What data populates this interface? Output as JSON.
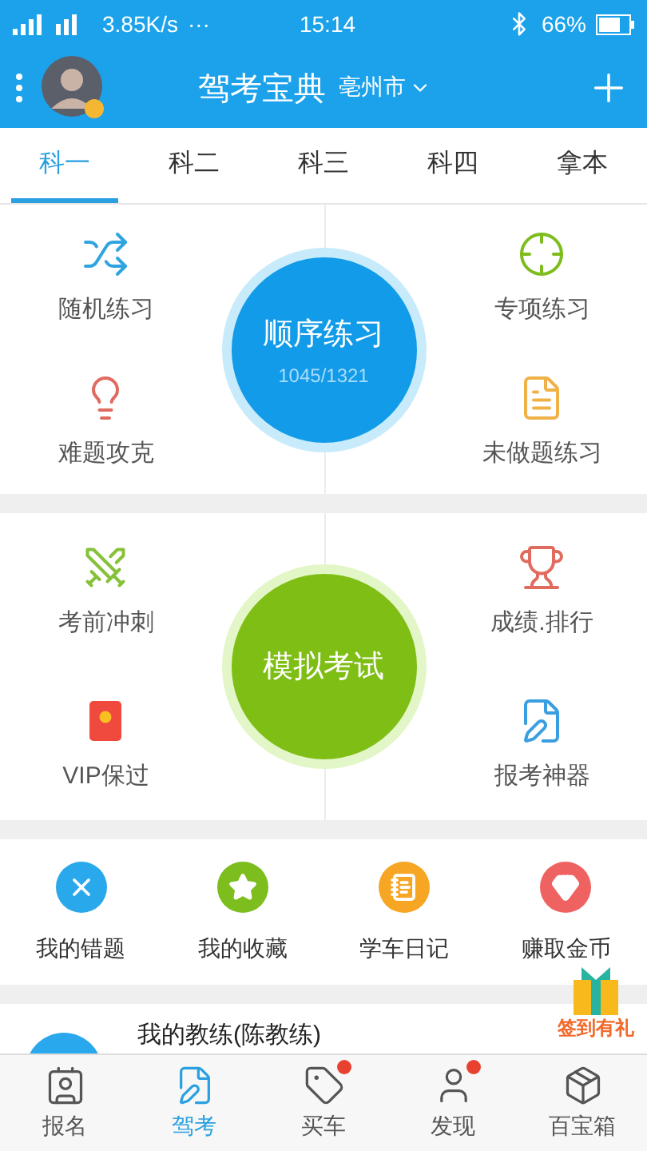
{
  "status_bar": {
    "network_speed": "3.85K/s",
    "more": "···",
    "time": "15:14",
    "battery": "66%"
  },
  "header": {
    "title": "驾考宝典",
    "city": "亳州市"
  },
  "tabs": [
    {
      "label": "科一",
      "selected": true
    },
    {
      "label": "科二",
      "selected": false
    },
    {
      "label": "科三",
      "selected": false
    },
    {
      "label": "科四",
      "selected": false
    },
    {
      "label": "拿本",
      "selected": false
    }
  ],
  "practice": {
    "center": {
      "title": "顺序练习",
      "progress": "1045/1321"
    },
    "items": [
      {
        "label": "随机练习"
      },
      {
        "label": "专项练习"
      },
      {
        "label": "难题攻克"
      },
      {
        "label": "未做题练习"
      }
    ]
  },
  "exam": {
    "center": {
      "title": "模拟考试"
    },
    "items": [
      {
        "label": "考前冲刺"
      },
      {
        "label": "成绩.排行"
      },
      {
        "label": "VIP保过"
      },
      {
        "label": "报考神器"
      }
    ]
  },
  "shortcuts": [
    {
      "label": "我的错题",
      "color": "#29a8ec"
    },
    {
      "label": "我的收藏",
      "color": "#7dbd1e"
    },
    {
      "label": "学车日记",
      "color": "#f6a623"
    },
    {
      "label": "赚取金币",
      "color": "#ef6262"
    }
  ],
  "gift": {
    "label": "签到有礼"
  },
  "coach": {
    "label": "我的教练(陈教练)"
  },
  "bottom_nav": [
    {
      "label": "报名",
      "selected": false,
      "dot": false
    },
    {
      "label": "驾考",
      "selected": true,
      "dot": false
    },
    {
      "label": "买车",
      "selected": false,
      "dot": true
    },
    {
      "label": "发现",
      "selected": false,
      "dot": true
    },
    {
      "label": "百宝箱",
      "selected": false,
      "dot": false
    }
  ]
}
